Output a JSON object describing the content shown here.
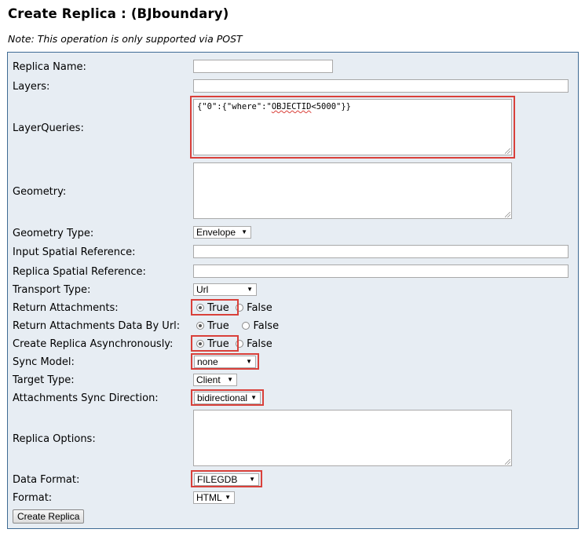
{
  "title": "Create Replica : (BJboundary)",
  "note": "Note: This operation is only supported via POST",
  "labels": {
    "replica_name": "Replica Name:",
    "layers": "Layers:",
    "layer_queries": "LayerQueries:",
    "geometry": "Geometry:",
    "geometry_type": "Geometry Type:",
    "input_sr": "Input Spatial Reference:",
    "replica_sr": "Replica Spatial Reference:",
    "transport_type": "Transport Type:",
    "return_attachments": "Return Attachments:",
    "return_attachments_by_url": "Return Attachments Data By Url:",
    "create_async": "Create Replica Asynchronously:",
    "sync_model": "Sync Model:",
    "target_type": "Target Type:",
    "attachments_sync_direction": "Attachments Sync Direction:",
    "replica_options": "Replica Options:",
    "data_format": "Data Format:",
    "format": "Format:"
  },
  "values": {
    "layer_queries_prefix": "{\"0\":{\"where\":\"",
    "layer_queries_word": "OBJECTID",
    "layer_queries_suffix": "<5000\"}}",
    "geometry_type": "Envelope",
    "transport_type": "Url",
    "sync_model": "none",
    "target_type": "Client",
    "attachments_sync_direction": "bidirectional",
    "data_format": "FILEGDB",
    "format": "HTML"
  },
  "radio": {
    "true_label": "True",
    "false_label": "False"
  },
  "button": {
    "create_replica": "Create Replica"
  },
  "icons": {
    "dropdown": "▼"
  },
  "colors": {
    "highlight": "#d9403a",
    "panel_bg": "#e7edf3",
    "panel_border": "#3f6b94"
  }
}
